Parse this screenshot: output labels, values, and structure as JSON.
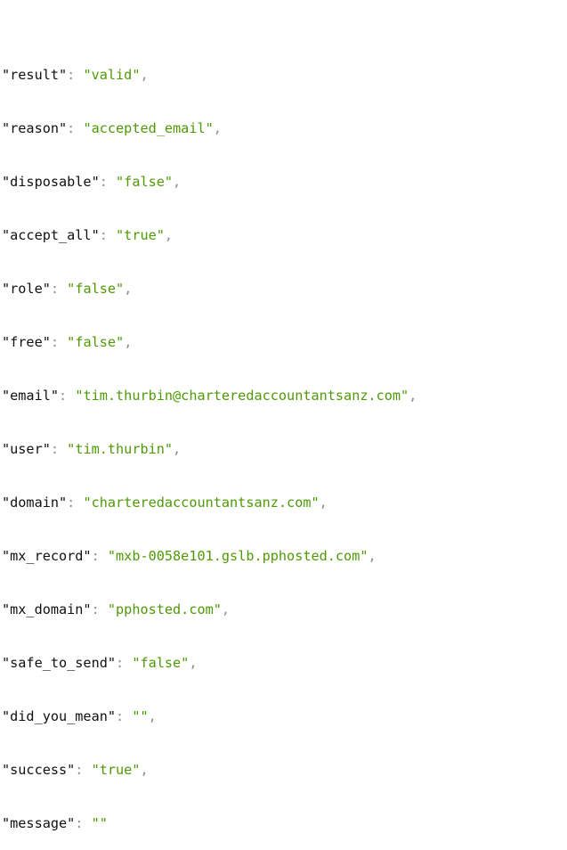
{
  "colors": {
    "key": "#111111",
    "punctuation": "#8f8f8f",
    "string_value": "#4e9a06",
    "background": "#ffffff"
  },
  "lines": [
    {
      "key": "\"result\"",
      "value": "\"valid\"",
      "trailing": ","
    },
    {
      "key": "\"reason\"",
      "value": "\"accepted_email\"",
      "trailing": ","
    },
    {
      "key": "\"disposable\"",
      "value": "\"false\"",
      "trailing": ","
    },
    {
      "key": "\"accept_all\"",
      "value": "\"true\"",
      "trailing": ","
    },
    {
      "key": "\"role\"",
      "value": "\"false\"",
      "trailing": ","
    },
    {
      "key": "\"free\"",
      "value": "\"false\"",
      "trailing": ","
    },
    {
      "key": "\"email\"",
      "value": "\"tim.thurbin@charteredaccountantsanz.com\"",
      "trailing": ","
    },
    {
      "key": "\"user\"",
      "value": "\"tim.thurbin\"",
      "trailing": ","
    },
    {
      "key": "\"domain\"",
      "value": "\"charteredaccountantsanz.com\"",
      "trailing": ","
    },
    {
      "key": "\"mx_record\"",
      "value": "\"mxb-0058e101.gslb.pphosted.com\"",
      "trailing": ","
    },
    {
      "key": "\"mx_domain\"",
      "value": "\"pphosted.com\"",
      "trailing": ","
    },
    {
      "key": "\"safe_to_send\"",
      "value": "\"false\"",
      "trailing": ","
    },
    {
      "key": "\"did_you_mean\"",
      "value": "\"\"",
      "trailing": ","
    },
    {
      "key": "\"success\"",
      "value": "\"true\"",
      "trailing": ","
    },
    {
      "key": "\"message\"",
      "value": "\"\"",
      "trailing": ""
    }
  ],
  "separator": ": "
}
